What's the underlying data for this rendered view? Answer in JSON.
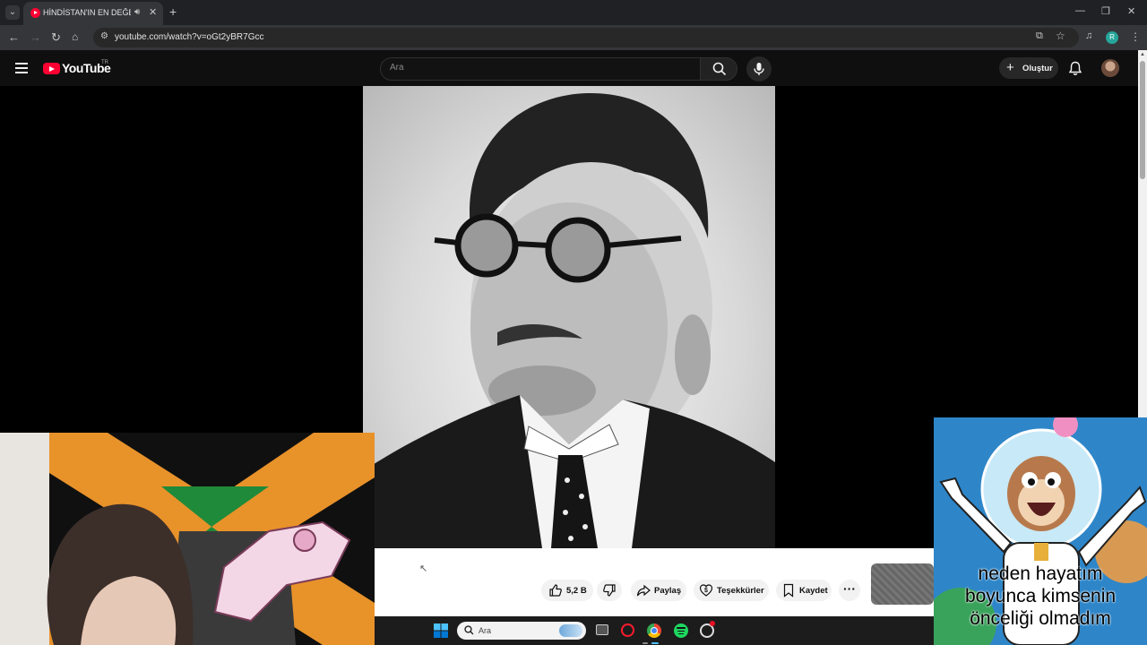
{
  "browser": {
    "tab_title": "HİNDİSTAN'IN EN DEĞERSİZ",
    "url": "youtube.com/watch?v=oGt2yBR7Gcc",
    "profile_initial": "R"
  },
  "masthead": {
    "logo_text": "YouTube",
    "country_code": "TR",
    "search_placeholder": "Ara",
    "create_label": "Oluştur"
  },
  "actions": {
    "like_count": "5,2 B",
    "share_label": "Paylaş",
    "thanks_label": "Teşekkürler",
    "save_label": "Kaydet"
  },
  "overlay": {
    "meme_caption_line1": "neden hayatım",
    "meme_caption_line2": "boyunca kimsenin",
    "meme_caption_line3": "önceliği olmadım"
  },
  "taskbar": {
    "search_placeholder": "Ara"
  },
  "colors": {
    "youtube_red": "#ff0033",
    "spotify_green": "#1ed760",
    "windows_blue": "#0078d4"
  }
}
